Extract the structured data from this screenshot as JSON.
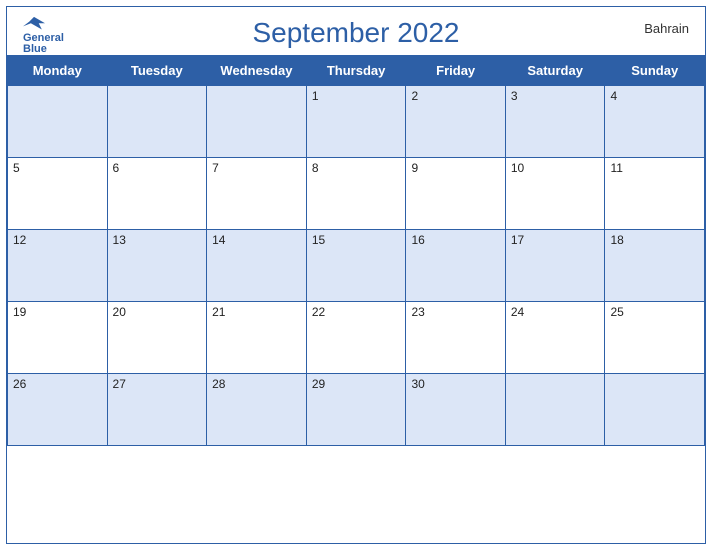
{
  "calendar": {
    "title": "September 2022",
    "country": "Bahrain",
    "logo": {
      "general": "General",
      "blue": "Blue"
    },
    "weekdays": [
      "Monday",
      "Tuesday",
      "Wednesday",
      "Thursday",
      "Friday",
      "Saturday",
      "Sunday"
    ],
    "weeks": [
      [
        null,
        null,
        null,
        1,
        2,
        3,
        4
      ],
      [
        5,
        6,
        7,
        8,
        9,
        10,
        11
      ],
      [
        12,
        13,
        14,
        15,
        16,
        17,
        18
      ],
      [
        19,
        20,
        21,
        22,
        23,
        24,
        25
      ],
      [
        26,
        27,
        28,
        29,
        30,
        null,
        null
      ]
    ]
  }
}
